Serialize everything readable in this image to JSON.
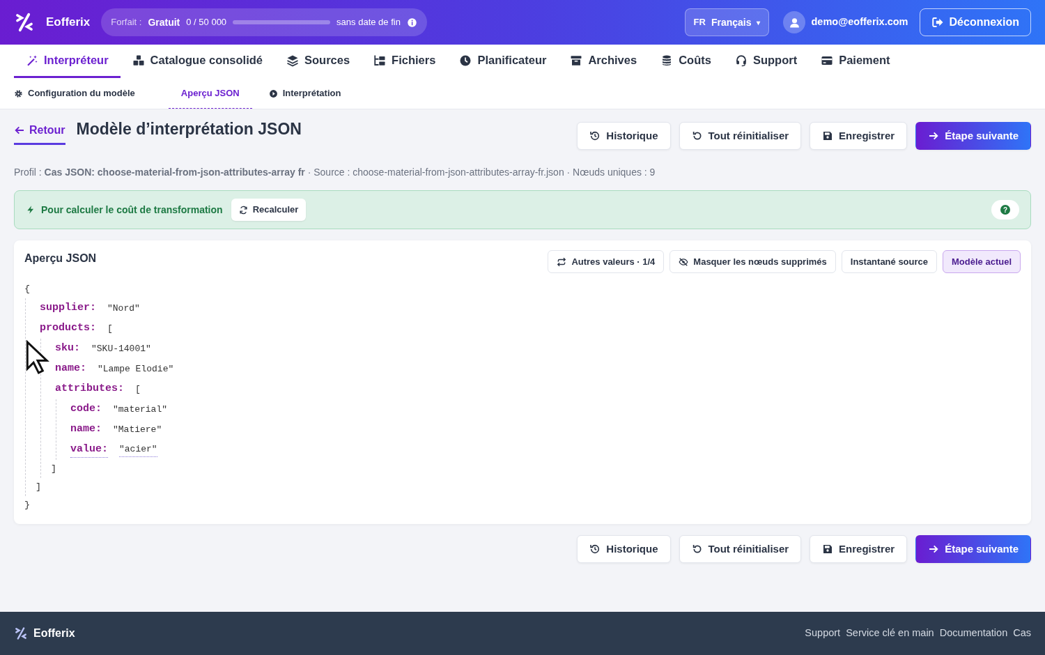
{
  "header": {
    "brand": "Eofferix",
    "plan": {
      "label": "Forfait :",
      "name": "Gratuit",
      "usage": "0 / 50 000",
      "level": 0,
      "end": "sans date de fin"
    },
    "language": {
      "code": "FR",
      "name": "Français",
      "caret": "▾"
    },
    "user": "demo@eofferix.com",
    "logout": "Déconnexion"
  },
  "nav": [
    {
      "label": "Interpréteur",
      "selected": true
    },
    {
      "label": "Catalogue consolidé",
      "selected": false
    },
    {
      "label": "Sources",
      "selected": false
    },
    {
      "label": "Fichiers",
      "selected": false
    },
    {
      "label": "Planificateur",
      "selected": false
    },
    {
      "label": "Archives",
      "selected": false
    },
    {
      "label": "Coûts",
      "selected": false
    },
    {
      "label": "Support",
      "selected": false
    },
    {
      "label": "Paiement",
      "selected": false
    }
  ],
  "subnav": [
    {
      "label": "Configuration du modèle",
      "selected": false
    },
    {
      "label": "Aperçu JSON",
      "selected": true
    },
    {
      "label": "Interprétation",
      "selected": false
    }
  ],
  "page": {
    "back": "Retour",
    "title": "Modèle d’interprétation JSON",
    "actions": [
      {
        "label": "Historique",
        "kind": "default"
      },
      {
        "label": "Tout réinitialiser",
        "kind": "default"
      },
      {
        "label": "Enregistrer",
        "kind": "default"
      },
      {
        "label": "Étape suivante",
        "kind": "primary"
      }
    ],
    "meta": "Profil : **Cas JSON: choose-material-from-json-attributes-array fr** · Source : choose-material-from-json-attributes-array-fr.json · Nœuds uniques : 9"
  },
  "alert": {
    "text": "Pour calculer le coût de transformation",
    "button": "Recalculer",
    "help": "?"
  },
  "card": {
    "title": "Aperçu JSON",
    "tools": [
      {
        "label": "Autres valeurs · 1/4",
        "selected": false
      },
      {
        "label": "Masquer les nœuds supprimés",
        "selected": false
      },
      {
        "label": "Instantané source",
        "selected": false
      },
      {
        "label": "Modèle actuel",
        "selected": true
      }
    ],
    "tree": {
      "open": "{",
      "close": "}",
      "children": [
        {
          "key": "supplier:",
          "value": "\"Nord\"",
          "flagged": false
        },
        {
          "key": "products:",
          "open": "[",
          "close": "]",
          "children": [
            {
              "key": "sku:",
              "value": "\"SKU-14001\"",
              "flagged": false
            },
            {
              "key": "name:",
              "value": "\"Lampe Elodie\"",
              "flagged": false
            },
            {
              "key": "attributes:",
              "open": "[",
              "close": "]",
              "children": [
                {
                  "key": "code:",
                  "value": "\"material\"",
                  "flagged": false
                },
                {
                  "key": "name:",
                  "value": "\"Matiere\"",
                  "flagged": false
                },
                {
                  "key": "value:",
                  "value": "\"acier\"",
                  "flagged": true
                }
              ]
            }
          ]
        }
      ]
    }
  },
  "bottom_actions": [
    {
      "label": "Historique",
      "kind": "default"
    },
    {
      "label": "Tout réinitialiser",
      "kind": "default"
    },
    {
      "label": "Enregistrer",
      "kind": "default"
    },
    {
      "label": "Étape suivante",
      "kind": "primary"
    }
  ],
  "footer": {
    "brand": "Eofferix",
    "links": [
      "Support",
      "Service clé en main",
      "Documentation",
      "Cas"
    ]
  }
}
